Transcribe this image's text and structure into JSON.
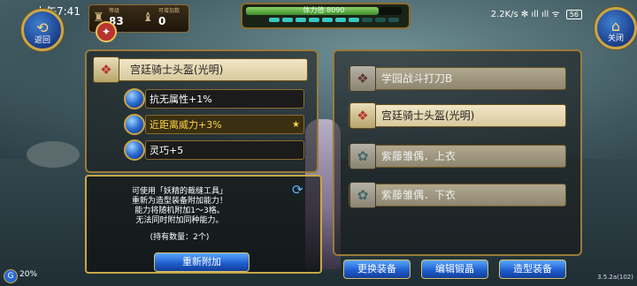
{
  "status_bar": {
    "time": "上午7:41",
    "network": "2.2K/s ✻ ıll ıll ᯤ",
    "battery": "56"
  },
  "top_left_button": {
    "label": "返回",
    "icon": "back-icon"
  },
  "top_right_button": {
    "label": "关闭",
    "icon": "home-icon"
  },
  "currency": {
    "item1": {
      "label": "等级",
      "value": "83"
    },
    "item2": {
      "label": "可增加数",
      "value": "0"
    }
  },
  "stamina": {
    "text": "体力值 8090",
    "fill_percent": 85,
    "segments_filled": 7,
    "segments_total": 10
  },
  "left_panel": {
    "selected_item": "宫廷骑士头盔(光明)",
    "attributes": [
      {
        "text": "抗无属性+1%",
        "highlight": false,
        "starred": false
      },
      {
        "text": "近距离威力+3%",
        "highlight": true,
        "starred": true
      },
      {
        "text": "灵巧+5",
        "highlight": false,
        "starred": false
      }
    ],
    "info_lines": [
      "可使用「妖精的裁缝工具」",
      "重新为造型装备附加能力！",
      "能力将随机附加1～3格。",
      "无法同时附加同种能力。"
    ],
    "owned_text": "(持有数量：2个)",
    "reattach_button": "重新附加"
  },
  "right_panel": {
    "items": [
      {
        "name": "学园战斗打刀B",
        "dim": true,
        "icon": "red"
      },
      {
        "name": "宫廷骑士头盔(光明)",
        "dim": false,
        "icon": "red"
      },
      {
        "name": "紫藤雏偶．上衣",
        "dim": true,
        "icon": "teal"
      },
      {
        "name": "紫藤雏偶．下衣",
        "dim": true,
        "icon": "teal"
      }
    ]
  },
  "bottom_buttons": {
    "change_equip": "更换装备",
    "edit_forge": "编辑锻晶",
    "style_equip": "造型装备"
  },
  "bottom_left": {
    "text": "20%"
  },
  "version": "3.5.2a(102)",
  "colors": {
    "gold_border": "#9b7a3a",
    "accent_blue": "#1f5fd0",
    "highlight_text": "#ffd54a"
  }
}
